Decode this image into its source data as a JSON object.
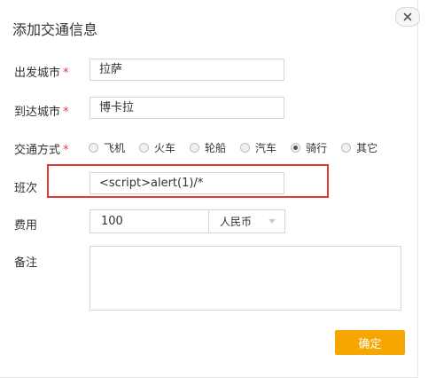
{
  "dialog": {
    "title": "添加交通信息"
  },
  "form": {
    "depart_city": {
      "label": "出发城市",
      "required_mark": "*",
      "value": "拉萨"
    },
    "arrive_city": {
      "label": "到达城市",
      "required_mark": "*",
      "value": "博卡拉"
    },
    "transport": {
      "label": "交通方式",
      "required_mark": "*",
      "options": [
        {
          "label": "飞机",
          "selected": false
        },
        {
          "label": "火车",
          "selected": false
        },
        {
          "label": "轮船",
          "selected": false
        },
        {
          "label": "汽车",
          "selected": false
        },
        {
          "label": "骑行",
          "selected": true
        },
        {
          "label": "其它",
          "selected": false
        }
      ]
    },
    "flight_no": {
      "label": "班次",
      "value": "<script>alert(1)/*"
    },
    "fee": {
      "label": "费用",
      "value": "100",
      "currency": "人民币"
    },
    "note": {
      "label": "备注",
      "value": ""
    }
  },
  "buttons": {
    "confirm": "确定"
  },
  "colors": {
    "accent": "#f7a600",
    "highlight": "#e03a3a",
    "required": "#e4393c"
  }
}
